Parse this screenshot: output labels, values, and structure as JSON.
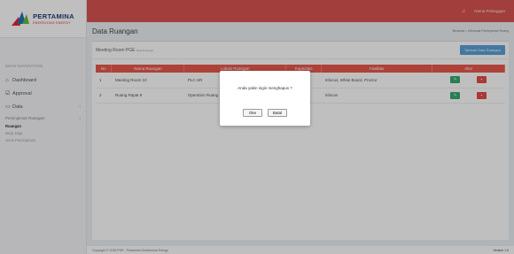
{
  "brand": {
    "name": "PERTAMINA",
    "tagline": "ENERGIZING ENERGY"
  },
  "topbar": {
    "bell_icon": "bell-icon",
    "user_name": "Nama Pelanggan"
  },
  "sidebar": {
    "header": "MAIN NAVIGATION",
    "items": [
      {
        "label": "Dashboard",
        "icon": "home-icon"
      },
      {
        "label": "Approval",
        "icon": "check-square-icon"
      },
      {
        "label": "Data",
        "icon": "folder-icon"
      }
    ],
    "sub": {
      "label": "Peminjaman Ruangan"
    },
    "children": [
      {
        "label": "Ruangan",
        "active": true
      },
      {
        "label": "Meja Jaga",
        "active": false
      },
      {
        "label": "Jenis Peminjaman",
        "active": false
      }
    ]
  },
  "page": {
    "title": "Data Ruangan",
    "breadcrumb": "Beranda > Informasi Peminjaman Ruang"
  },
  "box": {
    "title": "Meeting Room PGE",
    "subtitle": "Data Ruangan",
    "add_button": "Tambah Data Ruangan"
  },
  "table": {
    "headers": [
      "No",
      "Nama Ruangan",
      "Lokasi Ruangan",
      "Kapasitas",
      "Fasilitas",
      "Aksi"
    ],
    "rows": [
      {
        "no": "1",
        "nama": "Meeting Room 10",
        "lokasi": "PLC HR",
        "kapasitas": "",
        "fasilitas": "Infocus, White Board, Proctor"
      },
      {
        "no": "2",
        "nama": "Ruang Rapat 9",
        "lokasi": "Operation Ruang",
        "kapasitas": "",
        "fasilitas": "Infocus"
      }
    ]
  },
  "modal": {
    "message": "Anda yakin ingin menghapus ?",
    "ok_label": "Oke",
    "cancel_label": "Batal"
  },
  "footer": {
    "copyright": "Copyright © 2018 PGE . Pertamina Geothermal Energy",
    "version": "Version 1.0"
  },
  "colors": {
    "topbar": "#d9534f",
    "table_header": "#e8584c",
    "edit": "#37a96b",
    "delete": "#e34b48",
    "add_button": "#5aa0d6"
  }
}
